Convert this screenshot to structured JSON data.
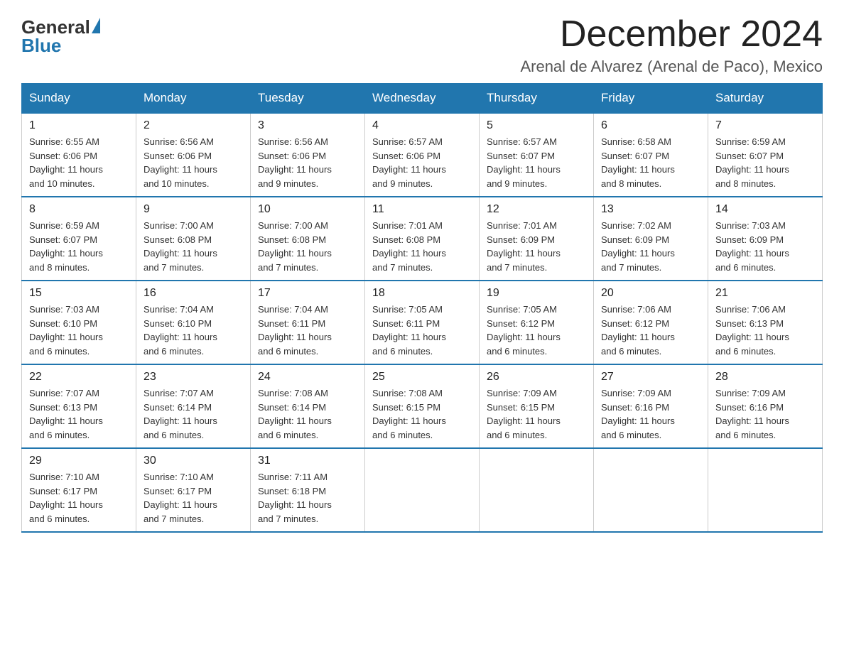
{
  "logo": {
    "general": "General",
    "blue": "Blue"
  },
  "title": "December 2024",
  "location": "Arenal de Alvarez (Arenal de Paco), Mexico",
  "weekdays": [
    "Sunday",
    "Monday",
    "Tuesday",
    "Wednesday",
    "Thursday",
    "Friday",
    "Saturday"
  ],
  "weeks": [
    [
      {
        "day": "1",
        "sunrise": "6:55 AM",
        "sunset": "6:06 PM",
        "daylight": "11 hours and 10 minutes."
      },
      {
        "day": "2",
        "sunrise": "6:56 AM",
        "sunset": "6:06 PM",
        "daylight": "11 hours and 10 minutes."
      },
      {
        "day": "3",
        "sunrise": "6:56 AM",
        "sunset": "6:06 PM",
        "daylight": "11 hours and 9 minutes."
      },
      {
        "day": "4",
        "sunrise": "6:57 AM",
        "sunset": "6:06 PM",
        "daylight": "11 hours and 9 minutes."
      },
      {
        "day": "5",
        "sunrise": "6:57 AM",
        "sunset": "6:07 PM",
        "daylight": "11 hours and 9 minutes."
      },
      {
        "day": "6",
        "sunrise": "6:58 AM",
        "sunset": "6:07 PM",
        "daylight": "11 hours and 8 minutes."
      },
      {
        "day": "7",
        "sunrise": "6:59 AM",
        "sunset": "6:07 PM",
        "daylight": "11 hours and 8 minutes."
      }
    ],
    [
      {
        "day": "8",
        "sunrise": "6:59 AM",
        "sunset": "6:07 PM",
        "daylight": "11 hours and 8 minutes."
      },
      {
        "day": "9",
        "sunrise": "7:00 AM",
        "sunset": "6:08 PM",
        "daylight": "11 hours and 7 minutes."
      },
      {
        "day": "10",
        "sunrise": "7:00 AM",
        "sunset": "6:08 PM",
        "daylight": "11 hours and 7 minutes."
      },
      {
        "day": "11",
        "sunrise": "7:01 AM",
        "sunset": "6:08 PM",
        "daylight": "11 hours and 7 minutes."
      },
      {
        "day": "12",
        "sunrise": "7:01 AM",
        "sunset": "6:09 PM",
        "daylight": "11 hours and 7 minutes."
      },
      {
        "day": "13",
        "sunrise": "7:02 AM",
        "sunset": "6:09 PM",
        "daylight": "11 hours and 7 minutes."
      },
      {
        "day": "14",
        "sunrise": "7:03 AM",
        "sunset": "6:09 PM",
        "daylight": "11 hours and 6 minutes."
      }
    ],
    [
      {
        "day": "15",
        "sunrise": "7:03 AM",
        "sunset": "6:10 PM",
        "daylight": "11 hours and 6 minutes."
      },
      {
        "day": "16",
        "sunrise": "7:04 AM",
        "sunset": "6:10 PM",
        "daylight": "11 hours and 6 minutes."
      },
      {
        "day": "17",
        "sunrise": "7:04 AM",
        "sunset": "6:11 PM",
        "daylight": "11 hours and 6 minutes."
      },
      {
        "day": "18",
        "sunrise": "7:05 AM",
        "sunset": "6:11 PM",
        "daylight": "11 hours and 6 minutes."
      },
      {
        "day": "19",
        "sunrise": "7:05 AM",
        "sunset": "6:12 PM",
        "daylight": "11 hours and 6 minutes."
      },
      {
        "day": "20",
        "sunrise": "7:06 AM",
        "sunset": "6:12 PM",
        "daylight": "11 hours and 6 minutes."
      },
      {
        "day": "21",
        "sunrise": "7:06 AM",
        "sunset": "6:13 PM",
        "daylight": "11 hours and 6 minutes."
      }
    ],
    [
      {
        "day": "22",
        "sunrise": "7:07 AM",
        "sunset": "6:13 PM",
        "daylight": "11 hours and 6 minutes."
      },
      {
        "day": "23",
        "sunrise": "7:07 AM",
        "sunset": "6:14 PM",
        "daylight": "11 hours and 6 minutes."
      },
      {
        "day": "24",
        "sunrise": "7:08 AM",
        "sunset": "6:14 PM",
        "daylight": "11 hours and 6 minutes."
      },
      {
        "day": "25",
        "sunrise": "7:08 AM",
        "sunset": "6:15 PM",
        "daylight": "11 hours and 6 minutes."
      },
      {
        "day": "26",
        "sunrise": "7:09 AM",
        "sunset": "6:15 PM",
        "daylight": "11 hours and 6 minutes."
      },
      {
        "day": "27",
        "sunrise": "7:09 AM",
        "sunset": "6:16 PM",
        "daylight": "11 hours and 6 minutes."
      },
      {
        "day": "28",
        "sunrise": "7:09 AM",
        "sunset": "6:16 PM",
        "daylight": "11 hours and 6 minutes."
      }
    ],
    [
      {
        "day": "29",
        "sunrise": "7:10 AM",
        "sunset": "6:17 PM",
        "daylight": "11 hours and 6 minutes."
      },
      {
        "day": "30",
        "sunrise": "7:10 AM",
        "sunset": "6:17 PM",
        "daylight": "11 hours and 7 minutes."
      },
      {
        "day": "31",
        "sunrise": "7:11 AM",
        "sunset": "6:18 PM",
        "daylight": "11 hours and 7 minutes."
      },
      null,
      null,
      null,
      null
    ]
  ],
  "labels": {
    "sunrise": "Sunrise:",
    "sunset": "Sunset:",
    "daylight": "Daylight:"
  }
}
